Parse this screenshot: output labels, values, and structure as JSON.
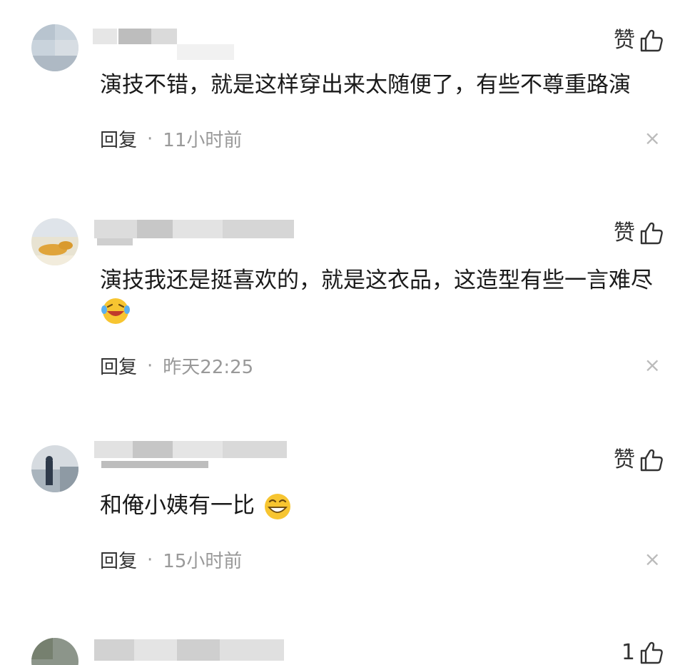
{
  "comments": [
    {
      "like_label": "赞",
      "text": "演技不错，就是这样穿出来太随便了，有些不尊重路演",
      "reply_label": "回复",
      "separator": "·",
      "time": "11小时前",
      "close_glyph": "×"
    },
    {
      "like_label": "赞",
      "text": "演技我还是挺喜欢的，就是这衣品，这造型有些一言难尽",
      "reply_label": "回复",
      "separator": "·",
      "time": "昨天22:25",
      "close_glyph": "×",
      "emoji": "laughing-tears-emoji"
    },
    {
      "like_label": "赞",
      "text": "和俺小姨有一比",
      "reply_label": "回复",
      "separator": "·",
      "time": "15小时前",
      "close_glyph": "×",
      "emoji": "grinning-emoji"
    },
    {
      "like_count": "1"
    }
  ],
  "icons": {
    "like": "thumbs-up-icon",
    "close": "close-icon"
  },
  "colors": {
    "text": "#1a1a1a",
    "meta": "#999999",
    "emoji": "#f7c531"
  }
}
